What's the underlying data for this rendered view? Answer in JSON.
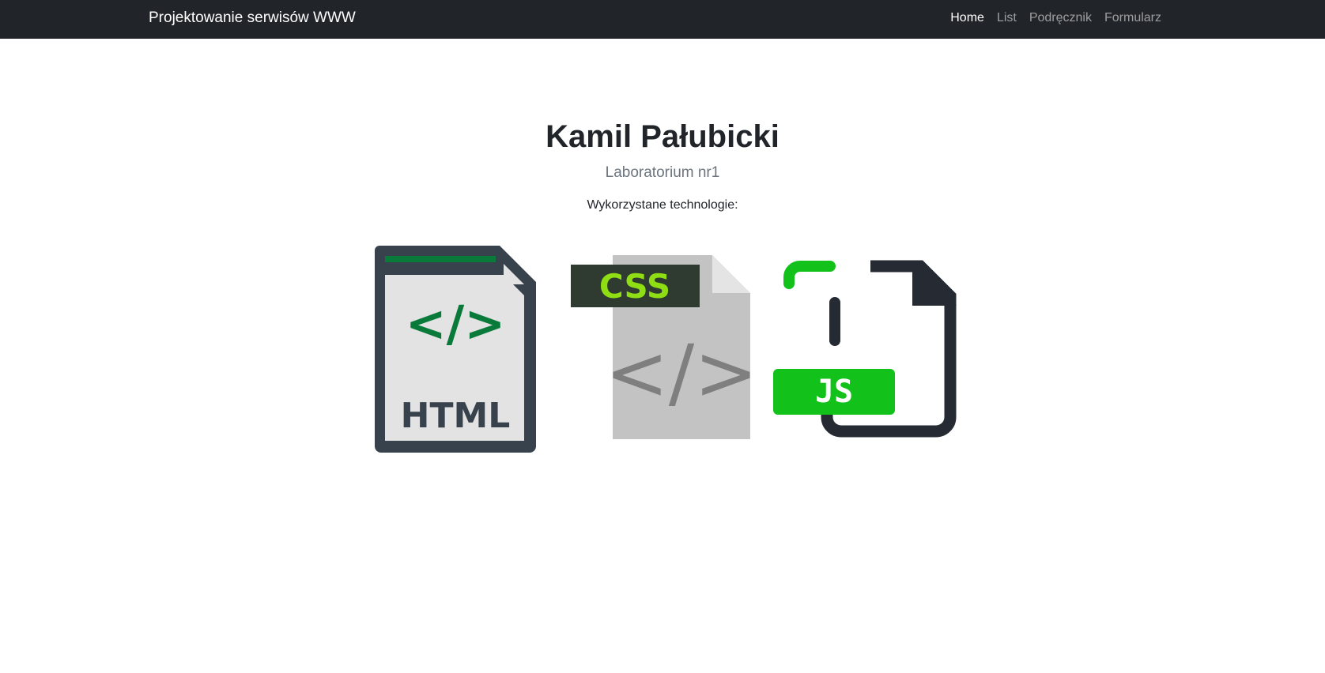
{
  "navbar": {
    "brand": "Projektowanie serwisów WWW",
    "links": [
      {
        "label": "Home",
        "active": true
      },
      {
        "label": "List",
        "active": false
      },
      {
        "label": "Podręcznik",
        "active": false
      },
      {
        "label": "Formularz",
        "active": false
      }
    ]
  },
  "header": {
    "title": "Kamil Pałubicki",
    "subtitle": "Laboratorium nr1",
    "tech_label": "Wykorzystane technologie:"
  },
  "technologies": [
    {
      "icon": "html-file-icon",
      "badge": "HTML",
      "accent": "#0a7a3b"
    },
    {
      "icon": "css-file-icon",
      "badge": "CSS",
      "accent": "#8ede13"
    },
    {
      "icon": "js-file-icon",
      "badge": "JS",
      "accent": "#12c11a"
    }
  ]
}
